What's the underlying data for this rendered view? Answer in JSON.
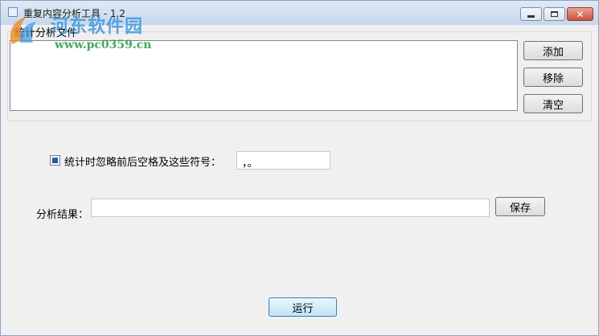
{
  "window": {
    "title": "重复内容分析工具 - 1.2",
    "minimize_icon": "minimize-icon",
    "maximize_icon": "maximize-icon",
    "close_icon": "close-icon"
  },
  "watermark": {
    "brand": "河东软件园",
    "url": "www.pc0359.cn"
  },
  "files": {
    "group_label": "统计分析文件",
    "items": [],
    "add_label": "添加",
    "remove_label": "移除",
    "clear_label": "清空"
  },
  "options": {
    "ignore_label": "统计时忽略前后空格及这些符号：",
    "ignore_checked": true,
    "symbols_value": "，。"
  },
  "result": {
    "label": "分析结果：",
    "value": "",
    "save_label": "保存"
  },
  "run_label": "运行",
  "colors": {
    "window_bg": "#f0f0f0",
    "titlebar": "#c6d7ec",
    "close_button": "#c9503a",
    "run_button": "#bfe3f7"
  }
}
